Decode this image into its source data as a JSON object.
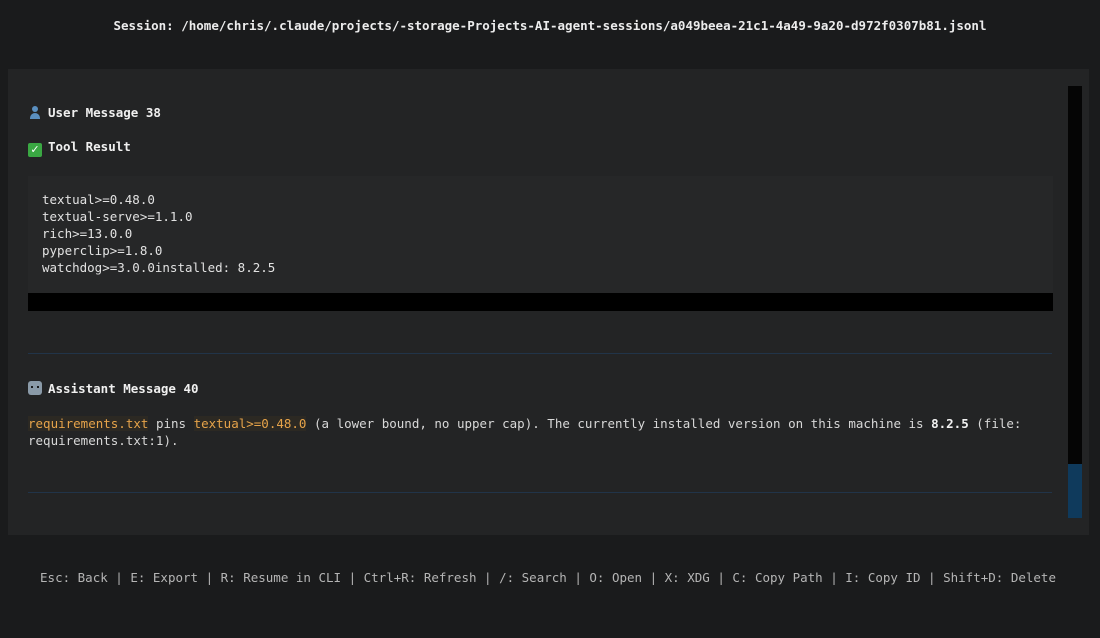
{
  "header": {
    "session_label": "Session: /home/chris/.claude/projects/-storage-Projects-AI-agent-sessions/a049beea-21c1-4a49-9a20-d972f0307b81.jsonl"
  },
  "messages": {
    "user": {
      "icon": "user-icon",
      "title": "User Message 38"
    },
    "tool_result": {
      "icon": "check-mark-icon",
      "title": "Tool Result",
      "lines": [
        "textual>=0.48.0",
        "textual-serve>=1.1.0",
        "rich>=13.0.0",
        "pyperclip>=1.8.0",
        "watchdog>=3.0.0installed: 8.2.5"
      ]
    },
    "assistant": {
      "icon": "robot-icon",
      "title": "Assistant Message 40",
      "code1": "requirements.txt",
      "text1": " pins ",
      "code2": "textual>=0.48.0",
      "text2": " (a lower bound, no upper cap). The currently installed version on this machine is ",
      "bold": "8.2.5",
      "text3": " (file:",
      "line2": "requirements.txt:1)."
    }
  },
  "footer": {
    "keybindings": "Esc: Back | E: Export | R: Resume in CLI | Ctrl+R: Refresh | /: Search | O: Open | X: XDG | C: Copy Path | I: Copy ID | Shift+D: Delete"
  },
  "colors": {
    "background": "#1a1b1c",
    "panel": "#232425",
    "code_highlight": "#e6a34a",
    "scroll_thumb": "#0f3a5c",
    "divider": "#213449"
  }
}
